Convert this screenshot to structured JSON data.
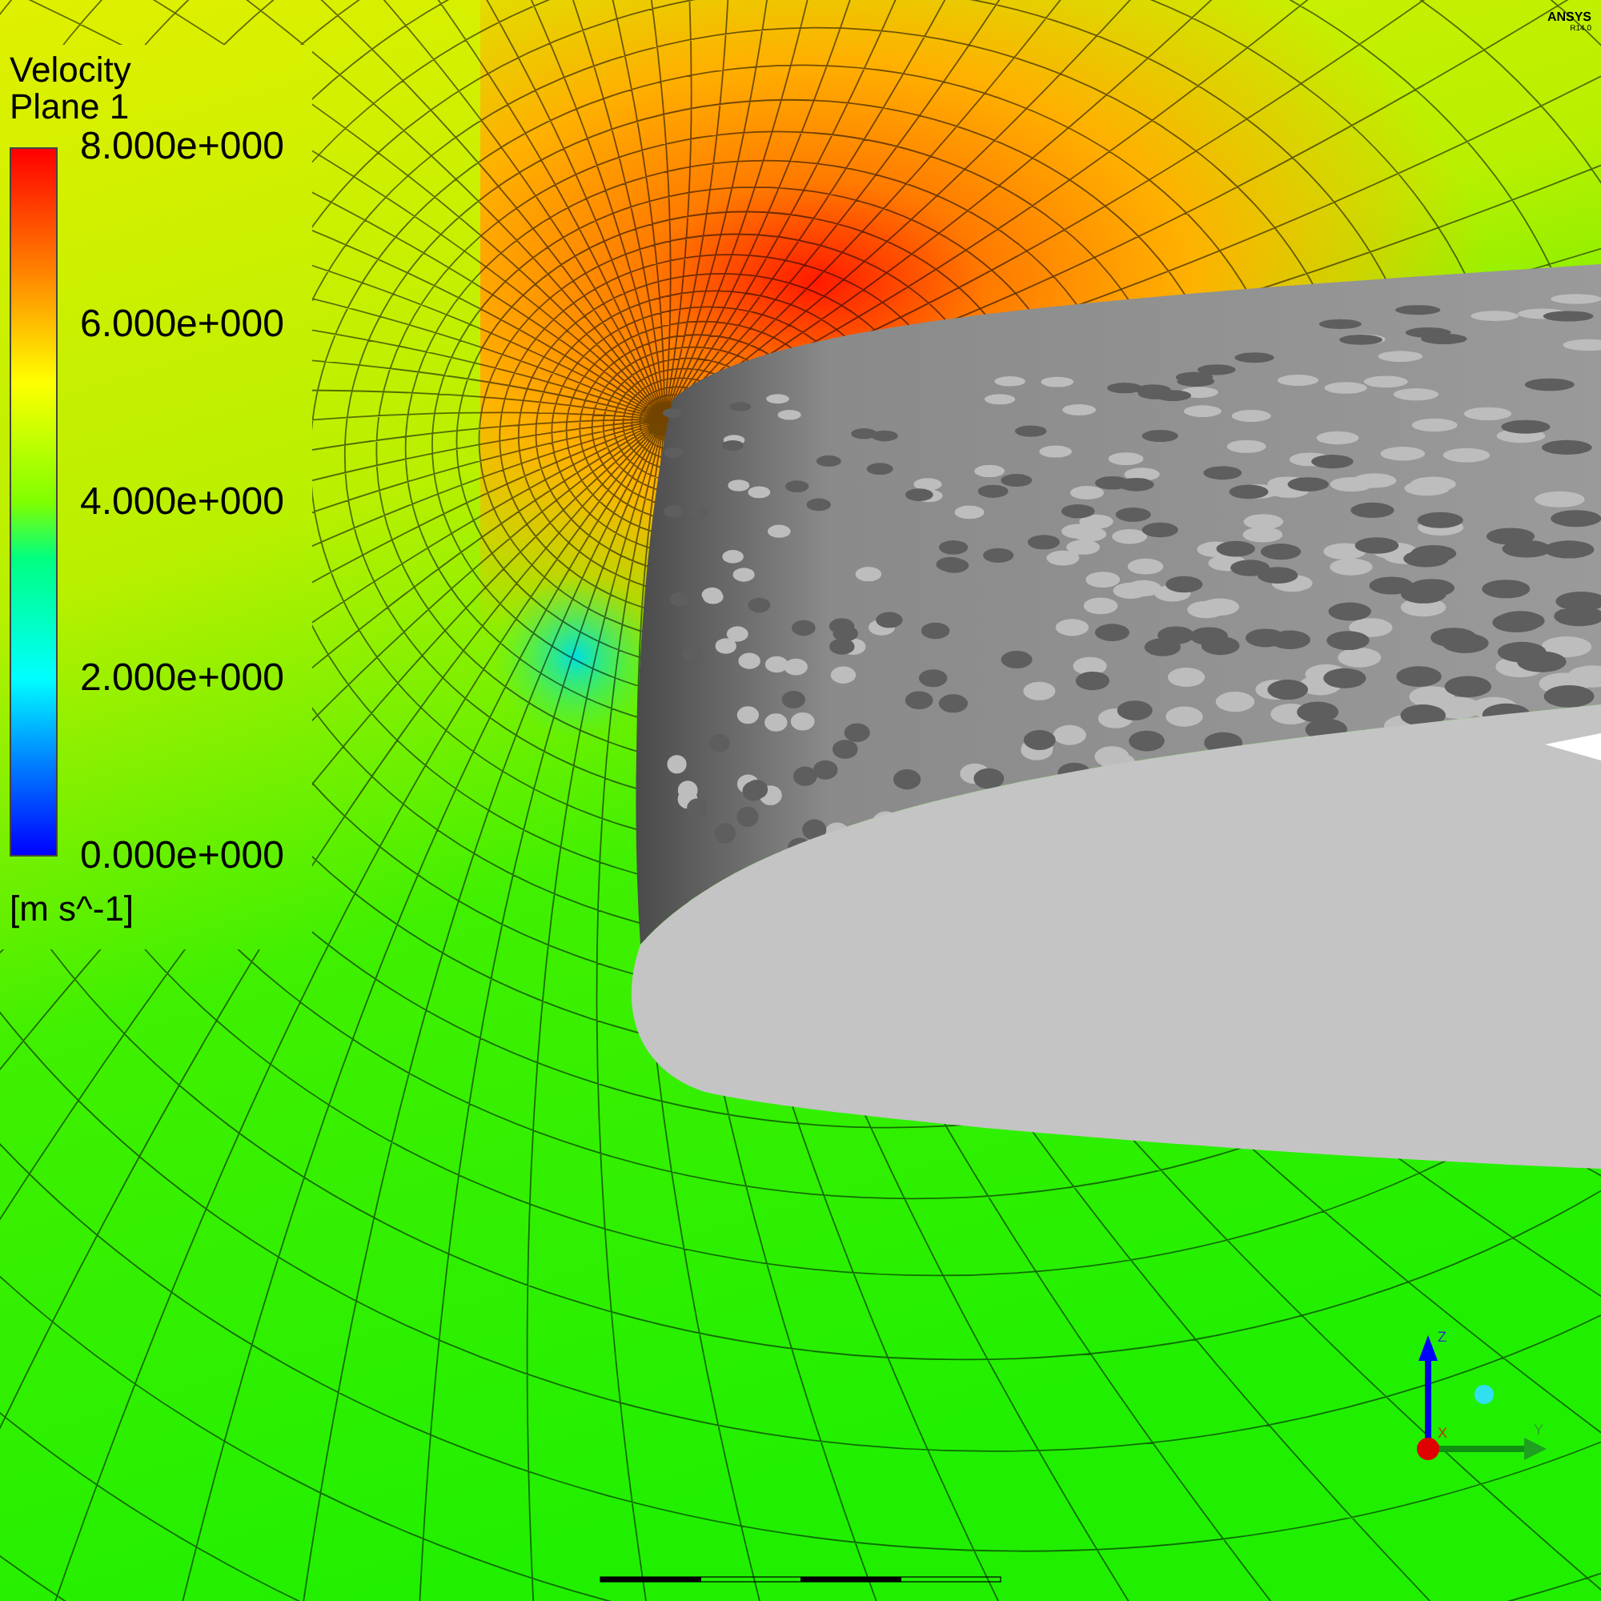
{
  "legend": {
    "title": "Velocity",
    "subtitle": "Plane 1",
    "ticks": [
      "8.000e+000",
      "6.000e+000",
      "4.000e+000",
      "2.000e+000",
      "0.000e+000"
    ],
    "unit": "[m s^-1]"
  },
  "logo": {
    "brand": "ANSYS",
    "version": "R14.0"
  },
  "triad": {
    "axes": [
      "X",
      "Y",
      "Z"
    ]
  }
}
